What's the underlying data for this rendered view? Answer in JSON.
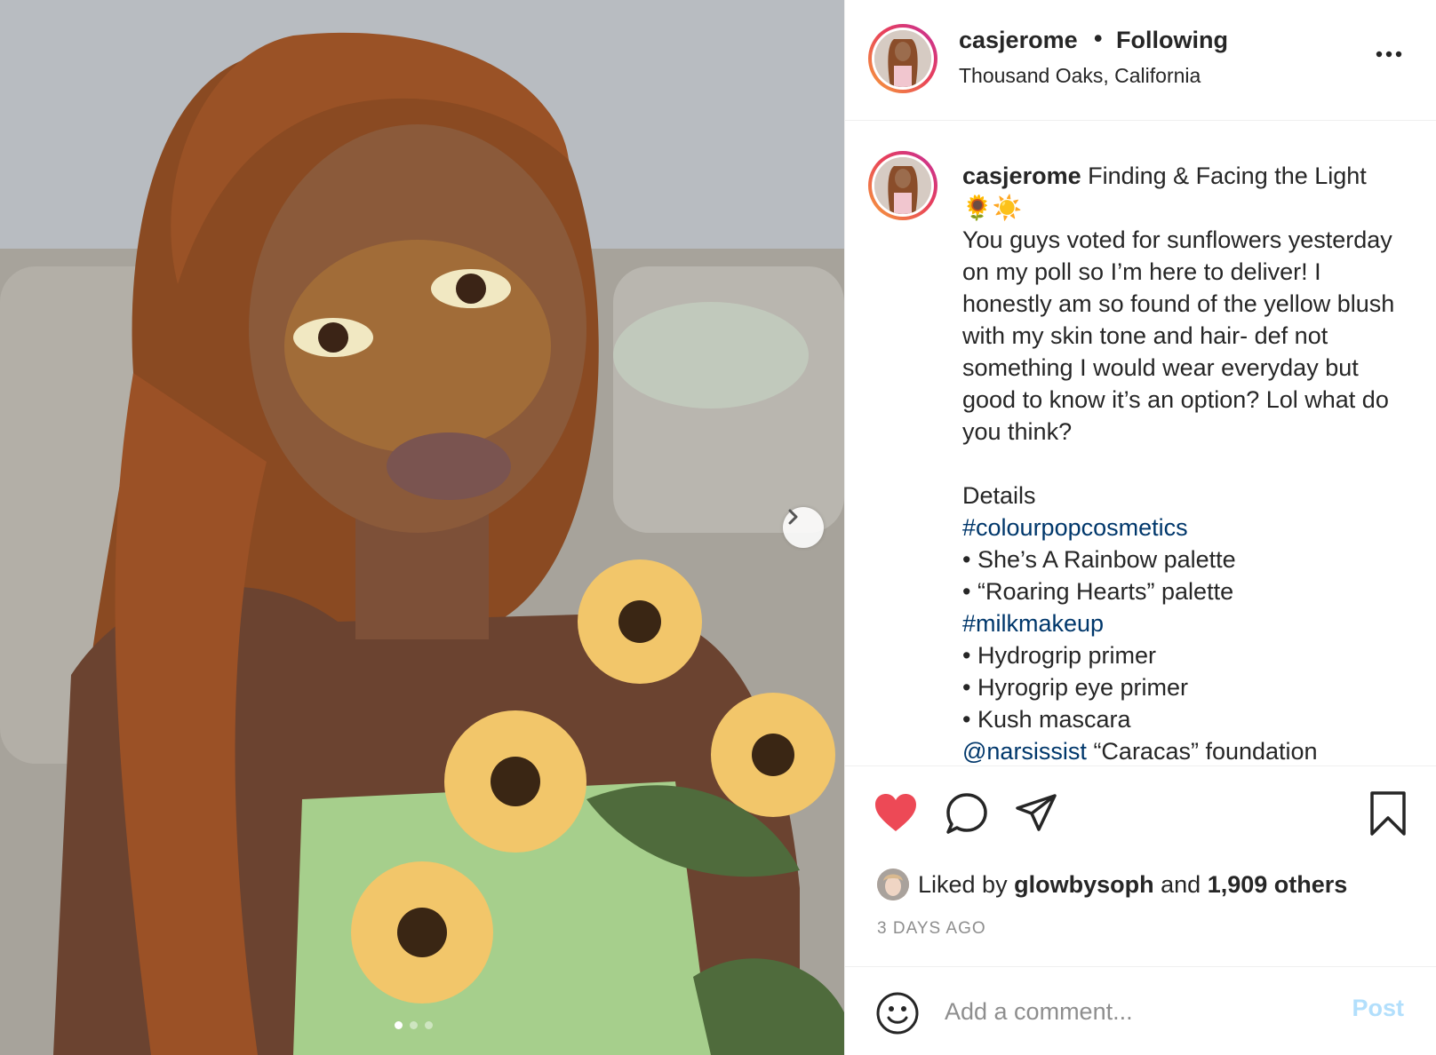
{
  "header": {
    "username": "casjerome",
    "separator": "•",
    "follow_status": "Following",
    "location": "Thousand Oaks, California"
  },
  "caption": {
    "username": "casjerome",
    "title": "Finding & Facing the Light",
    "emojis": "🌻☀️",
    "body": "You guys voted for sunflowers yesterday on my poll so I’m here to deliver! I honestly am so found of the yellow blush with my skin tone and hair- def not something I would wear everyday but good to know it’s an option? Lol what do you think?",
    "details_label": "Details",
    "tag1": "#colourpopcosmetics",
    "items1": [
      "• She’s A Rainbow palette",
      "• “Roaring Hearts” palette"
    ],
    "tag2": "#milkmakeup",
    "items2": [
      "• Hydrogrip primer",
      "• Hyrogrip eye primer",
      "• Kush mascara"
    ],
    "mention": "@narsissist",
    "mention_text": " “Caracas” foundation"
  },
  "likes": {
    "prefix": "Liked by",
    "user": "glowbysoph",
    "and": "and",
    "others": "1,909 others"
  },
  "timestamp": "3 DAYS AGO",
  "comment": {
    "placeholder": "Add a comment...",
    "post_label": "Post"
  },
  "carousel": {
    "total": 3,
    "active": 1
  },
  "icons": {
    "more": "more-options-icon",
    "like": "heart-icon",
    "comment": "comment-icon",
    "share": "share-icon",
    "save": "bookmark-icon",
    "emoji": "emoji-icon",
    "next": "chevron-right-icon"
  },
  "colors": {
    "like_active": "#ed4956",
    "link": "#00376b",
    "post_disabled": "#b2dffc",
    "muted": "#8e8e8e"
  }
}
